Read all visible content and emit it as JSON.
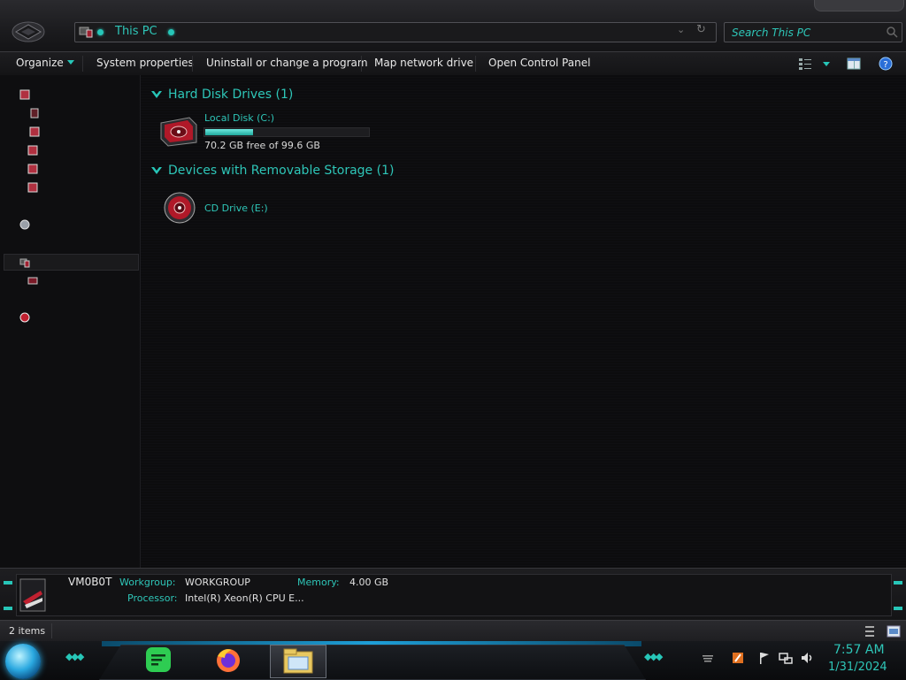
{
  "address": {
    "location": "This PC",
    "search_placeholder": "Search This PC"
  },
  "commands": {
    "organize": "Organize",
    "system_properties": "System properties",
    "uninstall": "Uninstall or change a program",
    "map_network": "Map network drive",
    "open_control_panel": "Open Control Panel"
  },
  "groups": {
    "hdd": "Hard Disk Drives (1)",
    "removable": "Devices with Removable Storage (1)"
  },
  "drives": {
    "local": {
      "name": "Local Disk (C:)",
      "free_text": "70.2 GB free of 99.6 GB",
      "used_fraction": 0.295
    },
    "cd": {
      "name": "CD Drive (E:)"
    }
  },
  "details": {
    "computer_name": "VM0B0T",
    "workgroup_label": "Workgroup:",
    "workgroup_value": "WORKGROUP",
    "memory_label": "Memory:",
    "memory_value": "4.00 GB",
    "processor_label": "Processor:",
    "processor_value": "Intel(R) Xeon(R) CPU E..."
  },
  "status": {
    "item_count": "2 items"
  },
  "clock": {
    "time": "7:57 AM",
    "date": "1/31/2024"
  },
  "colors": {
    "accent": "#2ec6b8",
    "background": "#0b0b0d",
    "drive_fill": "#27c6b8"
  },
  "icons": {
    "nav_back": "alien-nav-icon",
    "pc": "pc-icon",
    "drive": "hard-drive-icon",
    "cd": "cd-drive-icon",
    "start": "start-orb-icon",
    "taskbar_apps": [
      "notes-app-icon",
      "firefox-icon",
      "file-explorer-icon"
    ],
    "tray": [
      "power-icon",
      "flag-icon",
      "network-icon",
      "volume-icon"
    ]
  }
}
